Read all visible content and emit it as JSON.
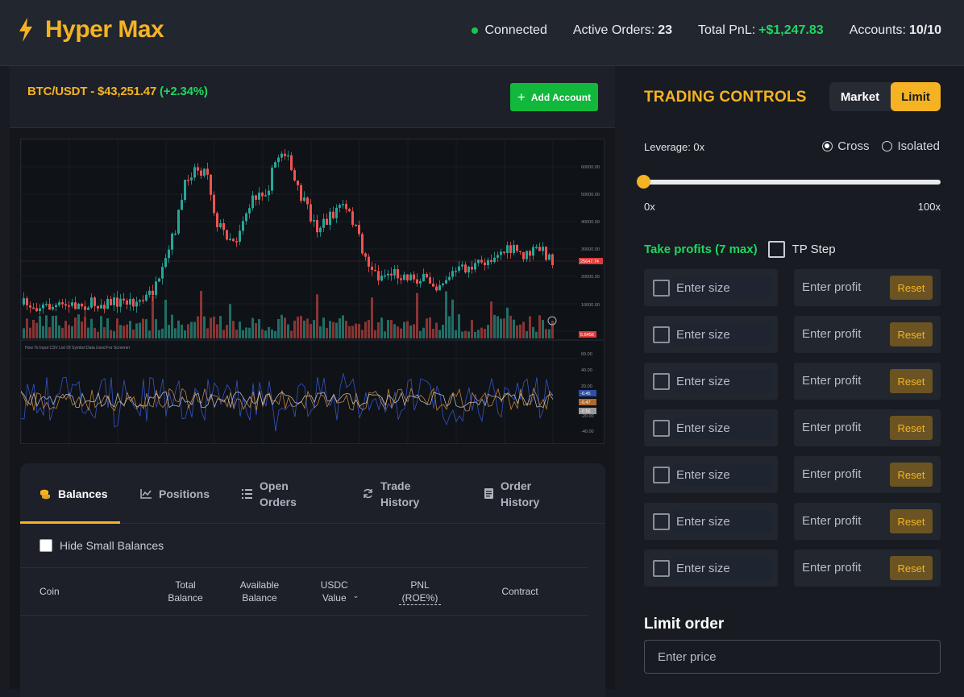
{
  "header": {
    "brand": "Hyper Max",
    "status": "Connected",
    "active_orders_label": "Active Orders:",
    "active_orders_value": "23",
    "total_pnl_label": "Total PnL:",
    "total_pnl_value": "+$1,247.83",
    "accounts_label": "Accounts:",
    "accounts_value": "10/10"
  },
  "pair": {
    "name_price": "BTC/USDT - $43,251.47",
    "change": "(+2.34%)",
    "add_account": "Add Account"
  },
  "chart": {
    "indicator_label": "How To Input CSV List Of Symbol Data Used For Screener",
    "price_ticks": [
      "60000.00",
      "50000.00",
      "40000.00",
      "30000.00",
      "20000.00",
      "10000.00"
    ],
    "current_price_tag": "25647.74",
    "volume_tag": "5.6456",
    "osc_ticks": [
      "60.00",
      "40.00",
      "20.00",
      "-20.00",
      "-40.00"
    ],
    "osc_tags": [
      "-0.45",
      "-0.47",
      "-0.56"
    ]
  },
  "tabs": [
    {
      "label": "Balances",
      "icon": "coins-icon"
    },
    {
      "label": "Positions",
      "icon": "line-chart-icon"
    },
    {
      "label": "Open Orders",
      "icon": "list-icon"
    },
    {
      "label": "Trade History",
      "icon": "refresh-icon"
    },
    {
      "label": "Order History",
      "icon": "document-icon"
    }
  ],
  "balances": {
    "hide_small": "Hide Small Balances",
    "columns": [
      "Coin",
      "Total Balance",
      "Available Balance",
      "USDC Value",
      "PNL (ROE%)",
      "Contract"
    ]
  },
  "controls": {
    "title": "TRADING CONTROLS",
    "market": "Market",
    "limit": "Limit",
    "leverage_label": "Leverage: 0x",
    "cross": "Cross",
    "isolated": "Isolated",
    "leverage_value": 0,
    "slider_min": "0x",
    "slider_max": "100x",
    "take_profits": "Take profits (7 max)",
    "tp_step": "TP Step",
    "size_placeholder": "Enter size",
    "profit_placeholder": "Enter profit",
    "reset": "Reset",
    "limit_order": "Limit order",
    "price_placeholder": "Enter price"
  },
  "colors": {
    "accent": "#f5b323",
    "positive": "#1ed760",
    "candle_up": "#26a69a",
    "candle_down": "#ef5350"
  }
}
